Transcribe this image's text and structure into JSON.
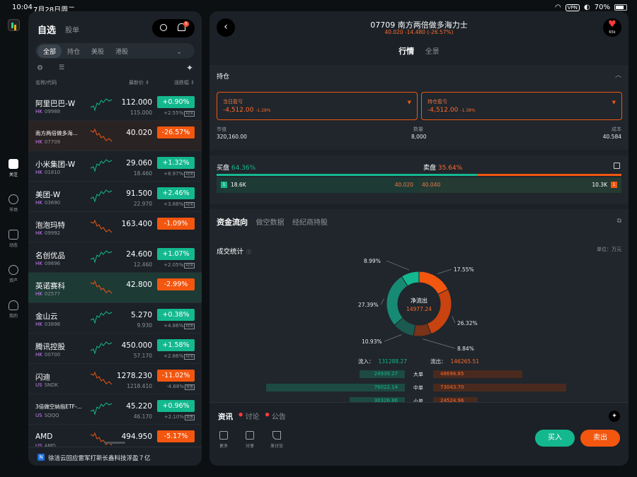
{
  "status": {
    "time": "10:04",
    "date": "7月28日周二",
    "vpn": "VPN",
    "battery": "70%"
  },
  "rail": [
    {
      "label": "关注",
      "icon": "trend-icon",
      "active": true
    },
    {
      "label": "市场",
      "icon": "compass-icon",
      "active": false
    },
    {
      "label": "动态",
      "icon": "feed-icon",
      "active": false
    },
    {
      "label": "资产",
      "icon": "pie-icon",
      "active": false
    },
    {
      "label": "我的",
      "icon": "person-icon",
      "active": false
    }
  ],
  "watchlist": {
    "tab_active": "自选",
    "tab_other": "股单",
    "bell_badge": "6",
    "filters": [
      "全部",
      "持仓",
      "美股",
      "港股"
    ],
    "filter_active": "全部",
    "col_name": "名称/代码",
    "col_price": "最新价 ⇕",
    "col_change": "涨跌幅 ⇕",
    "rows": [
      {
        "name": "阿里巴巴-W",
        "market": "HK",
        "code": "09988",
        "price": "112.000",
        "sub_price": "115.000",
        "change": "+0.90%",
        "sub_change": "+2.55%",
        "adr": "ADR",
        "dir": "up",
        "spark": "up"
      },
      {
        "name": "南方两倍做多海...",
        "market": "HK",
        "code": "07709",
        "price": "40.020",
        "sub_price": "",
        "change": "-26.57%",
        "sub_change": "",
        "adr": "",
        "dir": "dn",
        "spark": "dn",
        "small": true,
        "hl": "hl2"
      },
      {
        "name": "小米集团-W",
        "market": "HK",
        "code": "01810",
        "price": "29.060",
        "sub_price": "18.460",
        "change": "+1.32%",
        "sub_change": "+8.97%",
        "adr": "ADR",
        "dir": "up",
        "spark": "up"
      },
      {
        "name": "美团-W",
        "market": "HK",
        "code": "03690",
        "price": "91.500",
        "sub_price": "22.970",
        "change": "+2.46%",
        "sub_change": "+3.88%",
        "adr": "ADR",
        "dir": "up",
        "spark": "up"
      },
      {
        "name": "泡泡玛特",
        "market": "HK",
        "code": "09992",
        "price": "163.400",
        "sub_price": "",
        "change": "-1.09%",
        "sub_change": "",
        "adr": "",
        "dir": "dn",
        "spark": "dn"
      },
      {
        "name": "名创优品",
        "market": "HK",
        "code": "09896",
        "price": "24.600",
        "sub_price": "12.460",
        "change": "+1.07%",
        "sub_change": "+2.05%",
        "adr": "ADR",
        "dir": "up",
        "spark": "up"
      },
      {
        "name": "英诺赛科",
        "market": "HK",
        "code": "02577",
        "price": "42.800",
        "sub_price": "",
        "change": "-2.99%",
        "sub_change": "",
        "adr": "",
        "dir": "dn",
        "spark": "dn",
        "hl": "hl"
      },
      {
        "name": "金山云",
        "market": "HK",
        "code": "03896",
        "price": "5.270",
        "sub_price": "9.930",
        "change": "+0.38%",
        "sub_change": "+4.86%",
        "adr": "ADR",
        "dir": "up",
        "spark": "up"
      },
      {
        "name": "腾讯控股",
        "market": "HK",
        "code": "00700",
        "price": "450.000",
        "sub_price": "57.170",
        "change": "+1.58%",
        "sub_change": "+2.86%",
        "adr": "ADR",
        "dir": "up",
        "spark": "up"
      },
      {
        "name": "闪迪",
        "market": "US",
        "code": "SNDK",
        "price": "1278.230",
        "sub_price": "1218.410",
        "change": "-11.02%",
        "sub_change": "-4.68%",
        "adr": "夜盘",
        "dir": "dn",
        "spark": "dn"
      },
      {
        "name": "3倍做空纳指ETF-...",
        "market": "US",
        "code": "SQQQ",
        "price": "45.220",
        "sub_price": "46.170",
        "change": "+0.96%",
        "sub_change": "+2.10%",
        "adr": "夜盘",
        "dir": "up",
        "spark": "up",
        "small": true
      },
      {
        "name": "AMD",
        "market": "US",
        "code": "AMD",
        "price": "494.950",
        "sub_price": "",
        "change": "-5.17%",
        "sub_change": "",
        "adr": "",
        "dir": "dn",
        "spark": "dn"
      }
    ],
    "news": "徐洁云回应雷军打新长鑫科技浮盈７亿",
    "news_icon": "N"
  },
  "detail": {
    "title": "07709 南方两倍做多海力士",
    "subtitle": "40.020 -14.480 (-26.57%)",
    "fav_count": "65k",
    "tab_active": "行情",
    "tab_other": "全景",
    "position": {
      "title": "持仓",
      "today_label": "当日盈亏",
      "today_value": "-4,512.00",
      "today_pct": "-1.28%",
      "hold_label": "持仓盈亏",
      "hold_value": "-4,512.00",
      "hold_pct": "-1.38%",
      "mv_label": "市值",
      "mv_value": "320,160.00",
      "qty_label": "数量",
      "qty_value": "8,000",
      "cost_label": "成本",
      "cost_value": "40.584"
    },
    "orderbook": {
      "buy_label": "买盘",
      "buy_pct": "64.36%",
      "buy_share": 64.36,
      "sell_label": "卖盘",
      "sell_pct": "35.64%",
      "bid_qty": "18.6K",
      "bid_price": "40.020",
      "ask_price": "40.040",
      "ask_qty": "10.3K",
      "bid_level": "1",
      "ask_level": "1"
    },
    "flow": {
      "tabs": [
        "资金流向",
        "做空数据",
        "经纪商持股"
      ],
      "stat_title": "成交统计",
      "unit": "单位：万元",
      "center_label": "净流出",
      "center_value": "14977.24",
      "pie": [
        {
          "label": "17.55%",
          "value": 17.55,
          "color": "#f2560f"
        },
        {
          "label": "26.32%",
          "value": 26.32,
          "color": "#c8430f"
        },
        {
          "label": "8.84%",
          "value": 8.84,
          "color": "#7a3218"
        },
        {
          "label": "10.93%",
          "value": 10.93,
          "color": "#1a5a50"
        },
        {
          "label": "27.39%",
          "value": 27.39,
          "color": "#178a74"
        },
        {
          "label": "8.99%",
          "value": 8.99,
          "color": "#14b88e"
        }
      ],
      "inflow_label": "流入：",
      "inflow_value": "131288.27",
      "outflow_label": "流出：",
      "outflow_value": "146265.51",
      "breakdown": [
        {
          "label": "大单",
          "in": "24939.27",
          "out": "48696.85",
          "in_v": 24939.27,
          "out_v": 48696.85
        },
        {
          "label": "中单",
          "in": "76022.14",
          "out": "73043.70",
          "in_v": 76022.14,
          "out_v": 73043.7
        },
        {
          "label": "小单",
          "in": "30326.86",
          "out": "24524.96",
          "in_v": 30326.86,
          "out_v": 24524.96
        }
      ]
    },
    "bottom": {
      "tabs": [
        "资讯",
        "讨论",
        "公告"
      ],
      "tools": [
        "更多",
        "分享",
        "发讨论"
      ],
      "buy": "买入",
      "sell": "卖出"
    }
  }
}
